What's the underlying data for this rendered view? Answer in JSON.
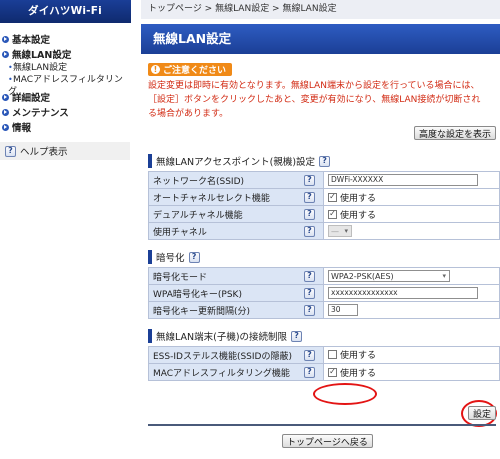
{
  "sidebar": {
    "brand": "ダイハツWi-Fi",
    "menu": [
      {
        "label": "基本設定"
      },
      {
        "label": "無線LAN設定",
        "subs": [
          "無線LAN設定",
          "MACアドレスフィルタリング"
        ]
      },
      {
        "label": "詳細設定"
      },
      {
        "label": "メンテナンス"
      },
      {
        "label": "情報"
      }
    ],
    "help_label": "ヘルプ表示"
  },
  "breadcrumb": "トップページ > 無線LAN設定 > 無線LAN設定",
  "page_title": "無線LAN設定",
  "caution": {
    "label": "ご注意ください",
    "text": "設定変更は即時に有効となります。無線LAN端末から設定を行っている場合には、［設定］ボタンをクリックしたあと、変更が有効になり、無線LAN接続が切断される場合があります。"
  },
  "advanced_button": "高度な設定を表示",
  "sections": {
    "ap": {
      "title": "無線LANアクセスポイント(親機)設定",
      "network_name": {
        "label": "ネットワーク名(SSID)",
        "value": "DWFi-XXXXXX"
      },
      "auto_channel": {
        "label": "オートチャネルセレクト機能",
        "checkbox_label": "使用する",
        "checked": true
      },
      "dual_channel": {
        "label": "デュアルチャネル機能",
        "checkbox_label": "使用する",
        "checked": true
      },
      "channel": {
        "label": "使用チャネル",
        "value": "—"
      }
    },
    "encryption": {
      "title": "暗号化",
      "mode": {
        "label": "暗号化モード",
        "value": "WPA2-PSK(AES)"
      },
      "key": {
        "label": "WPA暗号化キー(PSK)",
        "value": "xxxxxxxxxxxxxxx"
      },
      "interval": {
        "label": "暗号化キー更新間隔(分)",
        "value": "30"
      }
    },
    "restriction": {
      "title": "無線LAN端末(子機)の接続制限",
      "stealth": {
        "label": "ESS-IDステルス機能(SSIDの隠蔽)",
        "checkbox_label": "使用する",
        "checked": false
      },
      "mac_filter": {
        "label": "MACアドレスフィルタリング機能",
        "checkbox_label": "使用する",
        "checked": true
      }
    }
  },
  "buttons": {
    "save": "設定",
    "back_top": "トップページへ戻る"
  },
  "colors": {
    "title_bar": "#1b3f96",
    "label_bg": "#dbe5f5",
    "warning_text": "#d22b14",
    "caution_badge": "#f08a17",
    "highlight_circle": "#e31414"
  }
}
